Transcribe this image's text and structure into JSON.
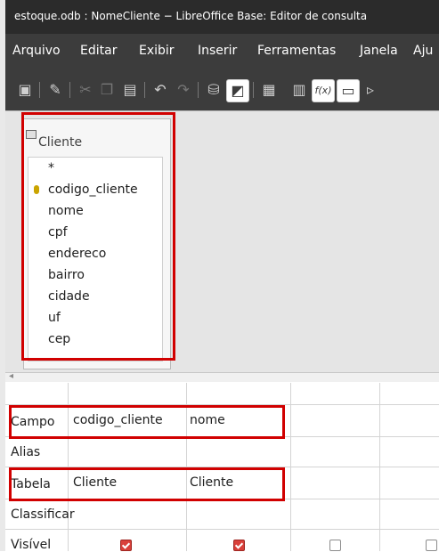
{
  "window": {
    "title": "estoque.odb : NomeCliente − LibreOffice Base: Editor de consulta"
  },
  "menu": [
    {
      "label": "Arquivo"
    },
    {
      "label": "Editar"
    },
    {
      "label": "Exibir"
    },
    {
      "label": "Inserir"
    },
    {
      "label": "Ferramentas"
    },
    {
      "label": "Janela"
    },
    {
      "label": "Aju"
    }
  ],
  "toolbar": {
    "icons": [
      "save-icon",
      "edit-design-icon",
      "cut-icon",
      "copy-icon",
      "paste-icon",
      "undo-icon",
      "redo-icon",
      "run-query-icon",
      "toggle-design-icon",
      "add-table-icon",
      "functions-icon",
      "table-name-icon",
      "distinct-icon"
    ],
    "functions_label": "f(x)"
  },
  "table_window": {
    "title": "Cliente",
    "fields": [
      "*",
      "codigo_cliente",
      "nome",
      "cpf",
      "endereco",
      "bairro",
      "cidade",
      "uf",
      "cep"
    ]
  },
  "grid": {
    "row_labels": {
      "campo": "Campo",
      "alias": "Alias",
      "tabela": "Tabela",
      "classificar": "Classificar",
      "visivel": "Visível"
    },
    "columns": [
      {
        "campo": "codigo_cliente",
        "tabela": "Cliente",
        "visivel": true
      },
      {
        "campo": "nome",
        "tabela": "Cliente",
        "visivel": true
      },
      {
        "campo": "",
        "tabela": "",
        "visivel": false
      },
      {
        "campo": "",
        "tabela": "",
        "visivel": false
      }
    ]
  }
}
